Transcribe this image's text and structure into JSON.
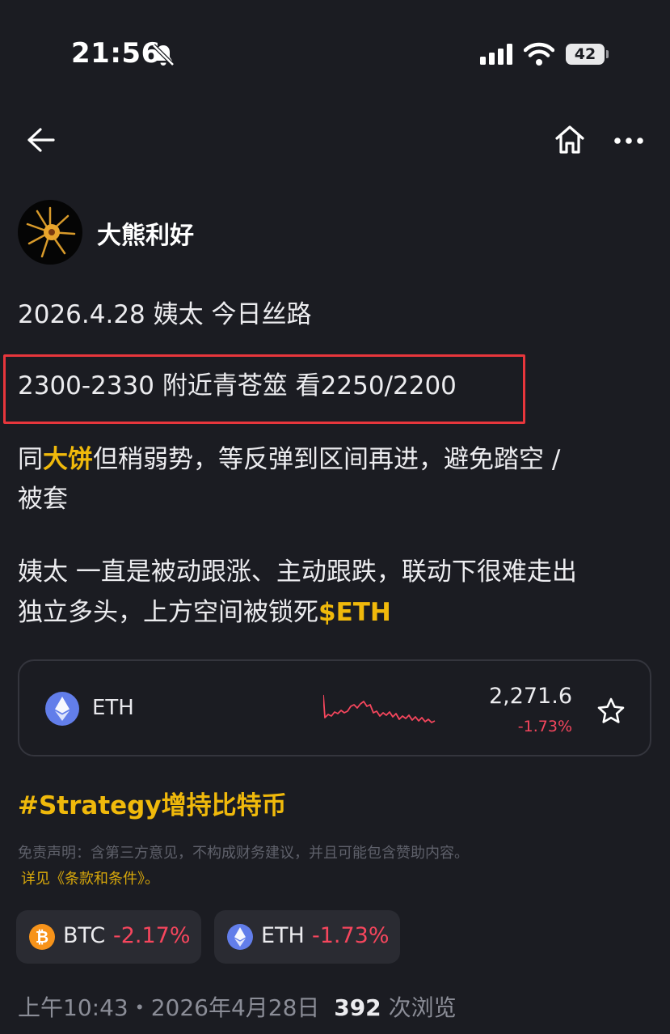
{
  "status_bar": {
    "time": "21:56",
    "battery": "42"
  },
  "author": {
    "name": "大熊利好"
  },
  "post": {
    "line1": "2026.4.28 姨太 今日丝路",
    "line2": "2300-2330 附近青苍筮  看2250/2200",
    "line3_pre": "同",
    "line3_highlight": "大饼",
    "line3_post": "但稍弱势，等反弹到区间再进，避免踏空 /",
    "line4": "被套",
    "line5": "姨太 一直是被动跟涨、主动跟跌，联动下很难走出",
    "line6_pre": "独立多头，上方空间被锁死",
    "line6_tag": "$ETH"
  },
  "ticker_card": {
    "symbol": "ETH",
    "price": "2,271.6",
    "change": "-1.73%"
  },
  "hashtag": "#Strategy增持比特币",
  "disclaimer": "免责声明：含第三方意见，不构成财务建议，并且可能包含赞助内容。",
  "terms": "详见《条款和条件》。",
  "chips": [
    {
      "symbol": "BTC",
      "change": "-2.17%"
    },
    {
      "symbol": "ETH",
      "change": "-1.73%"
    }
  ],
  "meta": {
    "time": "上午10:43・2026年4月28日",
    "views": "392",
    "views_label": "次浏览"
  },
  "colors": {
    "background": "#1b1c22",
    "highlight": "#f0b90b",
    "negative": "#f6465d",
    "box": "#e8363c"
  },
  "icons": [
    "bell-muted-icon",
    "signal-icon",
    "wifi-icon",
    "battery-icon",
    "back-arrow-icon",
    "home-icon",
    "more-icon",
    "eth-icon",
    "star-icon",
    "btc-icon"
  ]
}
